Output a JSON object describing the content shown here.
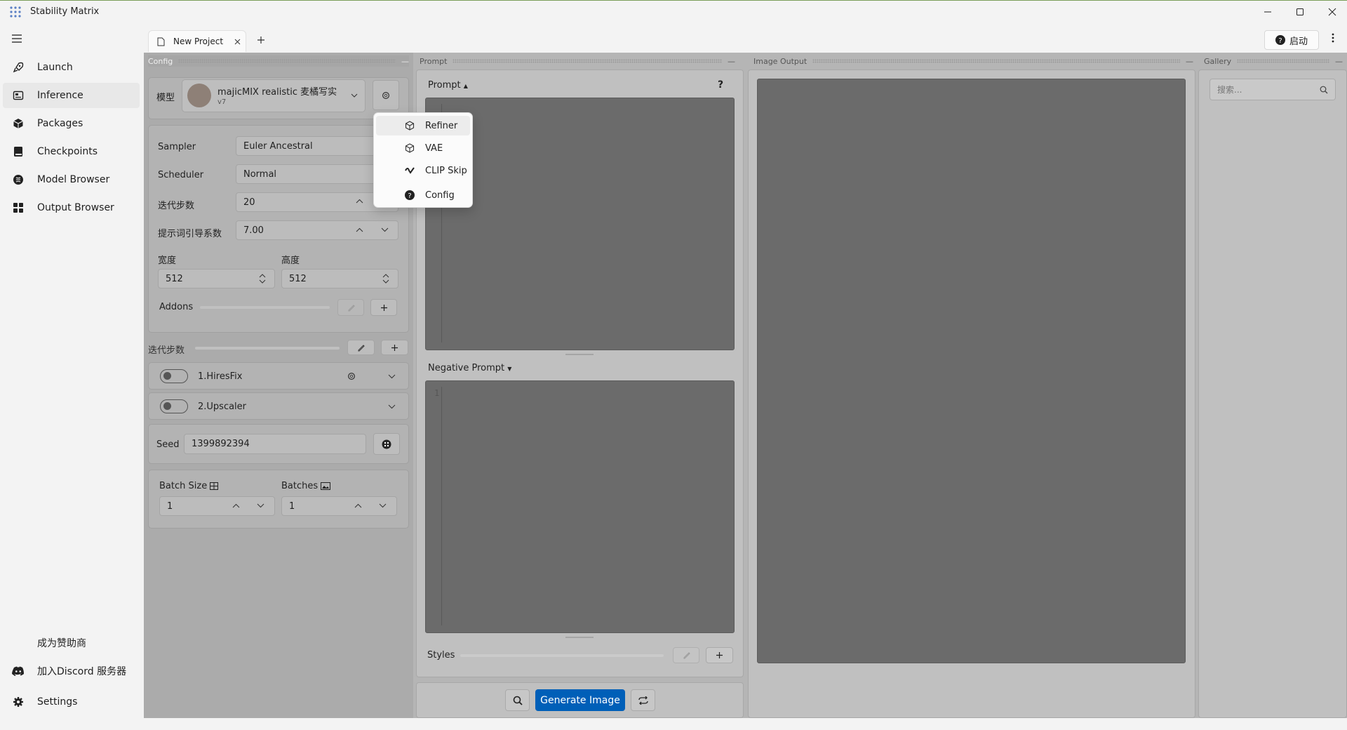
{
  "app": {
    "title": "Stability Matrix"
  },
  "nav": {
    "items": [
      {
        "label": "Launch"
      },
      {
        "label": "Inference"
      },
      {
        "label": "Packages"
      },
      {
        "label": "Checkpoints"
      },
      {
        "label": "Model Browser"
      },
      {
        "label": "Output Browser"
      }
    ],
    "footer": [
      {
        "label": "成为赞助商"
      },
      {
        "label": "加入Discord 服务器"
      },
      {
        "label": "Settings"
      }
    ]
  },
  "tabs": {
    "items": [
      {
        "label": "New Project"
      }
    ],
    "help_label": "启动"
  },
  "panels": {
    "config": "Config",
    "prompt": "Prompt",
    "image_output": "Image Output",
    "gallery": "Gallery"
  },
  "config": {
    "model_label": "模型",
    "model_name": "majicMIX realistic 麦橘写实",
    "model_version": "v7",
    "sampler_label": "Sampler",
    "sampler_value": "Euler Ancestral",
    "scheduler_label": "Scheduler",
    "scheduler_value": "Normal",
    "steps_label": "迭代步数",
    "steps_value": "20",
    "cfg_label": "提示词引导系数",
    "cfg_value": "7.00",
    "width_label": "宽度",
    "width_value": "512",
    "height_label": "高度",
    "height_value": "512",
    "addons_label": "Addons",
    "steps_section_label": "迭代步数",
    "hiresfix_label": "1.HiresFix",
    "upscaler_label": "2.Upscaler",
    "seed_label": "Seed",
    "seed_value": "1399892394",
    "batch_size_label": "Batch Size",
    "batch_size_value": "1",
    "batches_label": "Batches",
    "batches_value": "1"
  },
  "menu": {
    "items": [
      {
        "label": "Refiner"
      },
      {
        "label": "VAE"
      },
      {
        "label": "CLIP Skip"
      },
      {
        "label": "Config"
      }
    ]
  },
  "prompt": {
    "prompt_label": "Prompt",
    "help": "?",
    "negative_label": "Negative Prompt",
    "line1": "1",
    "styles_label": "Styles"
  },
  "bottom": {
    "generate_label": "Generate Image"
  },
  "gallery": {
    "search_placeholder": "搜索..."
  }
}
